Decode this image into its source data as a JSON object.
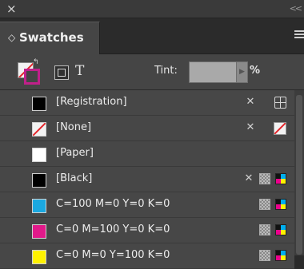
{
  "window": {
    "close_glyph": "×",
    "collapse_glyph": "<<"
  },
  "panel": {
    "title": "Swatches",
    "chevron": "◇"
  },
  "toolbar": {
    "text_mode": "T",
    "tint_label": "Tint:",
    "tint_value": "",
    "percent": "%"
  },
  "colors": {
    "none_red": "#e3262c",
    "magenta": "#c0208a",
    "panel_bg": "#474747"
  },
  "swatches": [
    {
      "name": "[Registration]",
      "chip": "#000000",
      "icons": [
        "no-edit-icon",
        "registration-icon"
      ]
    },
    {
      "name": "[None]",
      "chip": "none",
      "icons": [
        "no-edit-icon",
        "none-icon"
      ]
    },
    {
      "name": "[Paper]",
      "chip": "#ffffff",
      "icons": []
    },
    {
      "name": "[Black]",
      "chip": "#000000",
      "icons": [
        "no-edit-icon",
        "process-icon",
        "cmyk-icon"
      ]
    },
    {
      "name": "C=100 M=0 Y=0 K=0",
      "chip": "#1aa8e0",
      "icons": [
        "process-icon",
        "cmyk-icon"
      ]
    },
    {
      "name": "C=0 M=100 Y=0 K=0",
      "chip": "#e2198a",
      "icons": [
        "process-icon",
        "cmyk-icon"
      ]
    },
    {
      "name": "C=0 M=0 Y=100 K=0",
      "chip": "#fff200",
      "icons": [
        "process-icon",
        "cmyk-icon"
      ]
    }
  ]
}
